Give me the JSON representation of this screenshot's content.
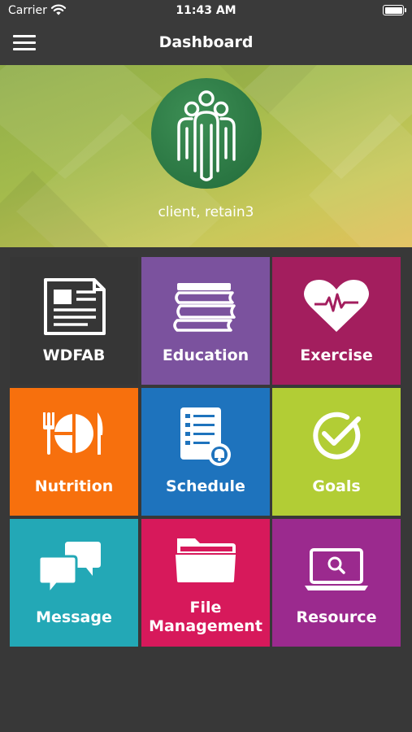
{
  "status_bar": {
    "carrier": "Carrier",
    "time": "11:43 AM"
  },
  "nav": {
    "title": "Dashboard"
  },
  "profile": {
    "name": "client, retain3"
  },
  "tiles": [
    {
      "label": "WDFAB",
      "color": "#363636",
      "icon": "newspaper-icon"
    },
    {
      "label": "Education",
      "color": "#7b529e",
      "icon": "books-icon"
    },
    {
      "label": "Exercise",
      "color": "#a31e5e",
      "icon": "heart-pulse-icon"
    },
    {
      "label": "Nutrition",
      "color": "#f7700d",
      "icon": "plate-utensils-icon"
    },
    {
      "label": "Schedule",
      "color": "#1e73bd",
      "icon": "checklist-bell-icon"
    },
    {
      "label": "Goals",
      "color": "#b2cd35",
      "icon": "check-circle-icon"
    },
    {
      "label": "Message",
      "color": "#23a8b6",
      "icon": "chat-bubbles-icon"
    },
    {
      "label": "File\nManagement",
      "color": "#d7195b",
      "icon": "folder-icon"
    },
    {
      "label": "Resource",
      "color": "#9b2a8e",
      "icon": "laptop-search-icon"
    }
  ]
}
